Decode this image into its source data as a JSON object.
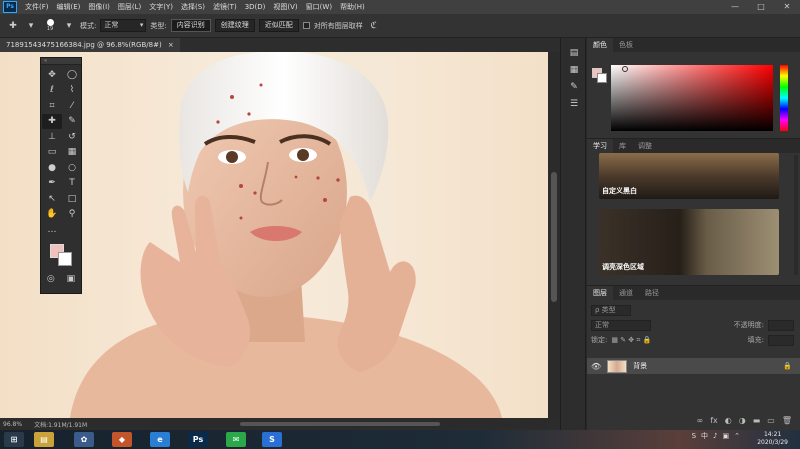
{
  "menubar": {
    "items": [
      "文件(F)",
      "编辑(E)",
      "图像(I)",
      "图层(L)",
      "文字(Y)",
      "选择(S)",
      "滤镜(T)",
      "3D(D)",
      "视图(V)",
      "窗口(W)",
      "帮助(H)"
    ],
    "app_icon": "Ps",
    "minimize": "—",
    "maximize": "□",
    "close": "✕"
  },
  "options": {
    "brush_size": "19",
    "mode_label": "模式:",
    "mode_value": "正常",
    "type_label": "类型:",
    "btn_content_aware": "内容识别",
    "btn_create_texture": "创建纹理",
    "btn_proximity_match": "近似匹配",
    "sample_all_layers": "对所有图层取样"
  },
  "document": {
    "tab_title": "71891543475166384.jpg @ 96.8%(RGB/8#)",
    "close": "×",
    "zoom": "96.8%",
    "doc_info": "文档:1.91M/1.91M"
  },
  "toolbox": {
    "grip": "«",
    "tools": [
      {
        "name": "move-tool",
        "icon": "✥"
      },
      {
        "name": "ellipse-marquee-tool",
        "icon": "◯"
      },
      {
        "name": "lasso-tool",
        "icon": "ℓ"
      },
      {
        "name": "quick-selection-tool",
        "icon": "⌇"
      },
      {
        "name": "crop-tool",
        "icon": "⌗"
      },
      {
        "name": "eyedropper-tool",
        "icon": "⁄"
      },
      {
        "name": "healing-brush-tool",
        "icon": "✚"
      },
      {
        "name": "brush-tool",
        "icon": "✎"
      },
      {
        "name": "clone-stamp-tool",
        "icon": "⊥"
      },
      {
        "name": "history-brush-tool",
        "icon": "↺"
      },
      {
        "name": "eraser-tool",
        "icon": "▭"
      },
      {
        "name": "gradient-tool",
        "icon": "▦"
      },
      {
        "name": "blur-tool",
        "icon": "●"
      },
      {
        "name": "dodge-tool",
        "icon": "○"
      },
      {
        "name": "pen-tool",
        "icon": "✒"
      },
      {
        "name": "type-tool",
        "icon": "T"
      },
      {
        "name": "path-selection-tool",
        "icon": "↖"
      },
      {
        "name": "rectangle-tool",
        "icon": "□"
      },
      {
        "name": "hand-tool",
        "icon": "✋"
      },
      {
        "name": "zoom-tool",
        "icon": "⚲"
      },
      {
        "name": "more-tools",
        "icon": "…"
      },
      {
        "name": "spacer",
        "icon": ""
      }
    ],
    "quick_mask": "◎",
    "screen_mode": "▣",
    "fg_color": "#f1c1bb",
    "bg_color": "#ffffff"
  },
  "panels": {
    "color_tabs": [
      "颜色",
      "色板"
    ],
    "learn_tabs": [
      "学习",
      "库",
      "调整"
    ],
    "learn_cards": [
      "自定义黑白",
      "调亮深色区域"
    ],
    "layers_tabs": [
      "图层",
      "通道",
      "路径"
    ],
    "layers": {
      "kind_filter": "ρ 类型",
      "blend_mode": "正常",
      "opacity_label": "不透明度:",
      "lock_label": "锁定:",
      "fill_label": "填充:",
      "layer_name": "背景",
      "lock_icon": "🔒",
      "footer_icons": [
        "∞",
        "fx",
        "◐",
        "◑",
        "▬",
        "▭",
        "🗑"
      ]
    }
  },
  "taskbar": {
    "time": "14:21",
    "date": "2020/3/29",
    "apps": [
      {
        "name": "start-button",
        "label": "⊞",
        "color": "#2a3a4a"
      },
      {
        "name": "file-explorer",
        "label": "▤",
        "color": "#c9a23a"
      },
      {
        "name": "app-network",
        "label": "✿",
        "color": "#3b5b8b"
      },
      {
        "name": "app-tools",
        "label": "◆",
        "color": "#c2552a"
      },
      {
        "name": "internet-explorer",
        "label": "e",
        "color": "#2a7fd4"
      },
      {
        "name": "photoshop",
        "label": "Ps",
        "color": "#0a2a4a"
      },
      {
        "name": "wechat",
        "label": "✉",
        "color": "#2aa84a"
      },
      {
        "name": "sogou",
        "label": "S",
        "color": "#2a6fd4"
      }
    ],
    "tray": [
      "S",
      "中",
      "♪",
      "▣",
      "⌃"
    ]
  }
}
